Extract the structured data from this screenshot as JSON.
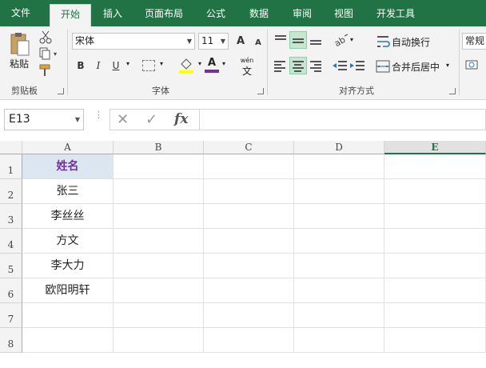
{
  "ribbon_tabs": [
    "文件",
    "开始",
    "插入",
    "页面布局",
    "公式",
    "数据",
    "审阅",
    "视图",
    "开发工具"
  ],
  "active_tab": "开始",
  "clipboard": {
    "paste_label": "粘贴",
    "group_label": "剪贴板"
  },
  "font": {
    "name": "宋体",
    "size": "11",
    "group_label": "字体",
    "bold": "B",
    "italic": "I",
    "underline": "U",
    "font_color_glyph": "A",
    "grow_glyph": "A",
    "shrink_glyph": "A",
    "phonetic_glyph": "wén"
  },
  "alignment": {
    "wrap_label": "自动换行",
    "merge_label": "合并后居中",
    "group_label": "对齐方式"
  },
  "number": {
    "format": "常规"
  },
  "formula_bar": {
    "name_box": "E13",
    "fx": "fx",
    "cancel": "✕",
    "enter": "✓",
    "formula": ""
  },
  "colors": {
    "accent": "#217346",
    "header_fill": "#dce6f1",
    "header_text": "#7030a0"
  },
  "columns": [
    "A",
    "B",
    "C",
    "D",
    "E"
  ],
  "selected_column": "E",
  "rows": [
    "1",
    "2",
    "3",
    "4",
    "5",
    "6",
    "7",
    "8"
  ],
  "cells_colA": [
    "姓名",
    "张三",
    "李丝丝",
    "方文",
    "李大力",
    "欧阳明轩",
    "",
    ""
  ]
}
